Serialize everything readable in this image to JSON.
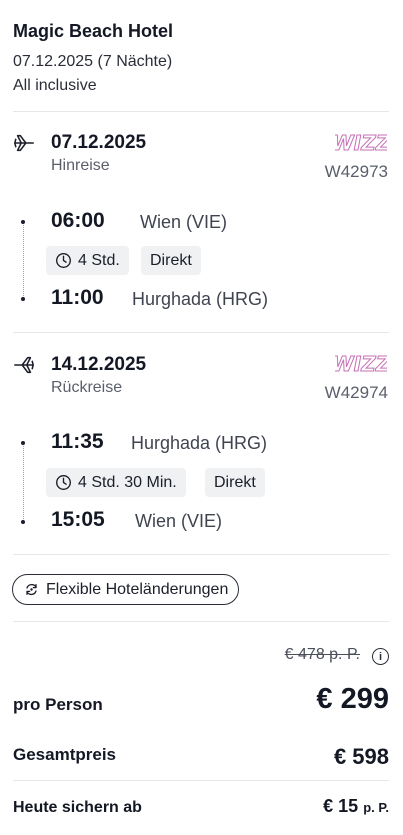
{
  "hotel": {
    "name": "Magic Beach Hotel",
    "date_nights": "07.12.2025 (7 Nächte)",
    "board": "All inclusive"
  },
  "outbound": {
    "date": "07.12.2025",
    "direction": "Hinreise",
    "airline_icon": "wizz-air-logo",
    "flight_number": "W42973",
    "departure_time": "06:00",
    "departure_place": "Wien (VIE)",
    "duration": "4 Std.",
    "stops": "Direkt",
    "arrival_time": "11:00",
    "arrival_place": "Hurghada (HRG)"
  },
  "return": {
    "date": "14.12.2025",
    "direction": "Rückreise",
    "airline_icon": "wizz-air-logo",
    "flight_number": "W42974",
    "departure_time": "11:35",
    "departure_place": "Hurghada (HRG)",
    "duration": "4 Std. 30 Min.",
    "stops": "Direkt",
    "arrival_time": "15:05",
    "arrival_place": "Wien (VIE)"
  },
  "flex": {
    "label": "Flexible Hoteländerungen",
    "icon": "refresh-icon"
  },
  "pricing": {
    "old_price": "€ 478 p. P.",
    "per_person_label": "pro Person",
    "per_person_value": "€ 299",
    "total_label": "Gesamtpreis",
    "total_value": "€ 598",
    "deposit_label": "Heute sichern ab",
    "deposit_value": "€ 15",
    "deposit_unit": "p. P."
  },
  "colors": {
    "airline_logo": "#c66fb6",
    "text_primary": "#141824",
    "text_secondary": "#5a5f6b",
    "chip_bg": "#f0f1f3"
  }
}
